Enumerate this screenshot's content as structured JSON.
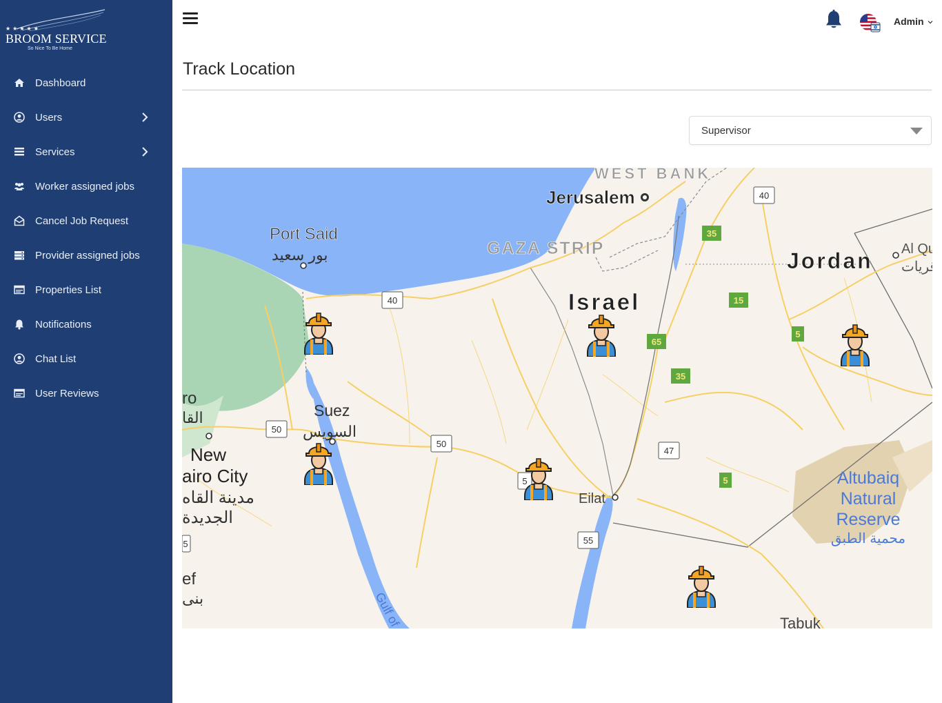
{
  "brand": {
    "stars": "★★★★★",
    "name": "BROOM SERVICE",
    "tagline": "So Nice To Be Home"
  },
  "sidebar": {
    "items": [
      {
        "label": "Dashboard",
        "icon": "home-icon",
        "has_submenu": false
      },
      {
        "label": "Users",
        "icon": "user-circle-icon",
        "has_submenu": true
      },
      {
        "label": "Services",
        "icon": "list-icon",
        "has_submenu": true
      },
      {
        "label": "Worker assigned jobs",
        "icon": "users-icon",
        "has_submenu": false
      },
      {
        "label": "Cancel Job Request",
        "icon": "envelope-open-icon",
        "has_submenu": false
      },
      {
        "label": "Provider assigned jobs",
        "icon": "server-icon",
        "has_submenu": false
      },
      {
        "label": "Properties List",
        "icon": "id-card-icon",
        "has_submenu": false
      },
      {
        "label": "Notifications",
        "icon": "bell-icon",
        "has_submenu": false
      },
      {
        "label": "Chat List",
        "icon": "user-circle-icon",
        "has_submenu": false
      },
      {
        "label": "User Reviews",
        "icon": "id-card-icon",
        "has_submenu": false
      }
    ]
  },
  "topbar": {
    "menu_icon": "hamburger-icon",
    "notification_icon": "bell-icon",
    "language_icon": "us-israel-flag-icon",
    "user_label": "Admin"
  },
  "page": {
    "title": "Track Location"
  },
  "filter": {
    "selected": "Supervisor"
  },
  "map": {
    "labels": {
      "west_bank": "WEST BANK",
      "jerusalem": "Jerusalem",
      "port_said": "Port Said",
      "port_said_ar": "بور سعيد",
      "gaza": "GAZA STRIP",
      "jordan": "Jordan",
      "al_qu": "Al Qu",
      "al_qu_ar": "قريات",
      "israel": "Israel",
      "suez": "Suez",
      "suez_ar": "السويس",
      "new_cairo_1": "New",
      "new_cairo_2": "airo City",
      "new_cairo_ar1": "مدينة القاه",
      "new_cairo_ar2": "الجديدة",
      "ro": "ro",
      "ro_ar": "القا",
      "eilat": "Eilat",
      "altubaiq_1": "Altubaiq",
      "altubaiq_2": "Natural",
      "altubaiq_3": "Reserve",
      "altubaiq_ar": "محمية الطبق",
      "tabuk": "Tabuk",
      "gulf": "Gulf of",
      "ef": "ef",
      "ef_ar": "بنى"
    },
    "road_shields": {
      "r40a": "40",
      "r40b": "40",
      "r50a": "50",
      "r50b": "50",
      "r55": "55",
      "r47": "47",
      "r5": "5",
      "r5b": "5",
      "r5c": "5",
      "r35a": "35",
      "r35b": "35",
      "r15": "15",
      "r65": "65",
      "r5d": "5"
    },
    "worker_icon": "construction-worker-icon"
  }
}
